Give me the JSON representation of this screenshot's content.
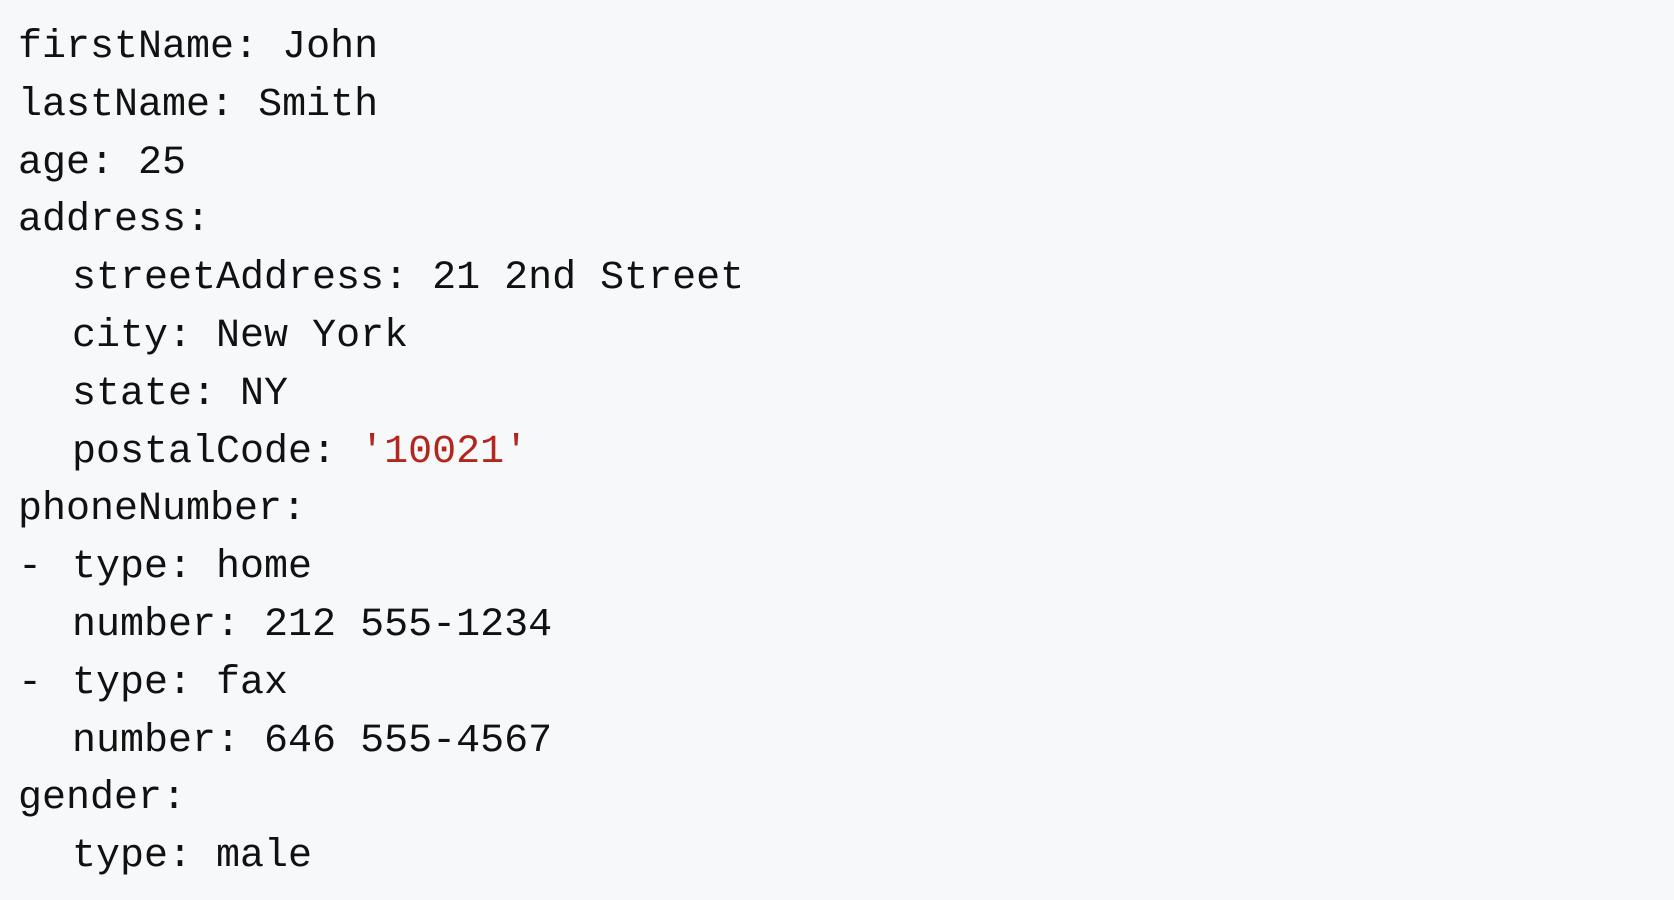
{
  "yaml": {
    "firstName": {
      "key": "firstName:",
      "value": "John"
    },
    "lastName": {
      "key": "lastName:",
      "value": "Smith"
    },
    "age": {
      "key": "age:",
      "value": "25"
    },
    "address": {
      "key": "address:",
      "streetAddress": {
        "key": "streetAddress:",
        "value": "21 2nd Street"
      },
      "city": {
        "key": "city:",
        "value": "New York"
      },
      "state": {
        "key": "state:",
        "value": "NY"
      },
      "postalCode": {
        "key": "postalCode:",
        "value": "'10021'"
      }
    },
    "phoneNumber": {
      "key": "phoneNumber:",
      "items": [
        {
          "dash": "-",
          "type_key": "type:",
          "type_value": "home",
          "number_key": "number:",
          "number_value": "212 555-1234"
        },
        {
          "dash": "-",
          "type_key": "type:",
          "type_value": "fax",
          "number_key": "number:",
          "number_value": "646 555-4567"
        }
      ]
    },
    "gender": {
      "key": "gender:",
      "type": {
        "key": "type:",
        "value": "male"
      }
    }
  },
  "colors": {
    "background": "#f7f8fa",
    "text": "#111111",
    "string_literal": "#b3261e"
  }
}
